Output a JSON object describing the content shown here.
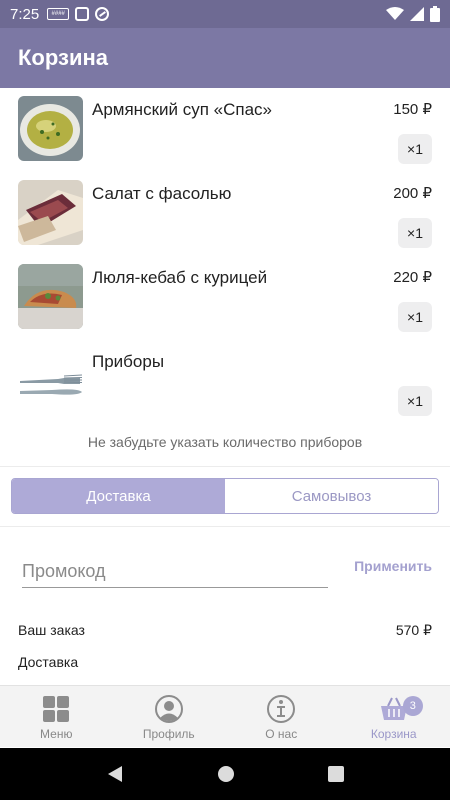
{
  "status_bar": {
    "time": "7:25",
    "mini_label": "####"
  },
  "header": {
    "title": "Корзина"
  },
  "cart": {
    "items": [
      {
        "name": "Армянский суп «Спас»",
        "price": "150 ₽",
        "qty": "×1",
        "image": "soup-image"
      },
      {
        "name": "Салат с фасолью",
        "price": "200 ₽",
        "qty": "×1",
        "image": "salad-image"
      },
      {
        "name": "Люля-кебаб с курицей",
        "price": "220 ₽",
        "qty": "×1",
        "image": "kebab-image"
      },
      {
        "name": "Приборы",
        "price": "",
        "qty": "×1",
        "image": "cutlery-image"
      }
    ],
    "reminder": "Не забудьте указать количество приборов"
  },
  "delivery_toggle": {
    "options": [
      "Доставка",
      "Самовывоз"
    ],
    "selected": "Доставка"
  },
  "promo": {
    "placeholder": "Промокод",
    "value": "",
    "apply_label": "Применить"
  },
  "summary": {
    "order_label": "Ваш заказ",
    "order_value": "570 ₽",
    "delivery_label": "Доставка"
  },
  "bottom_nav": {
    "items": [
      {
        "label": "Меню",
        "icon": "grid-icon"
      },
      {
        "label": "Профиль",
        "icon": "profile-icon"
      },
      {
        "label": "О нас",
        "icon": "info-icon"
      },
      {
        "label": "Корзина",
        "icon": "basket-icon",
        "badge": "3",
        "active": true
      }
    ]
  },
  "colors": {
    "primary": "#7c78a4",
    "accent": "#aeaad7",
    "status_bar": "#6e6a93"
  }
}
